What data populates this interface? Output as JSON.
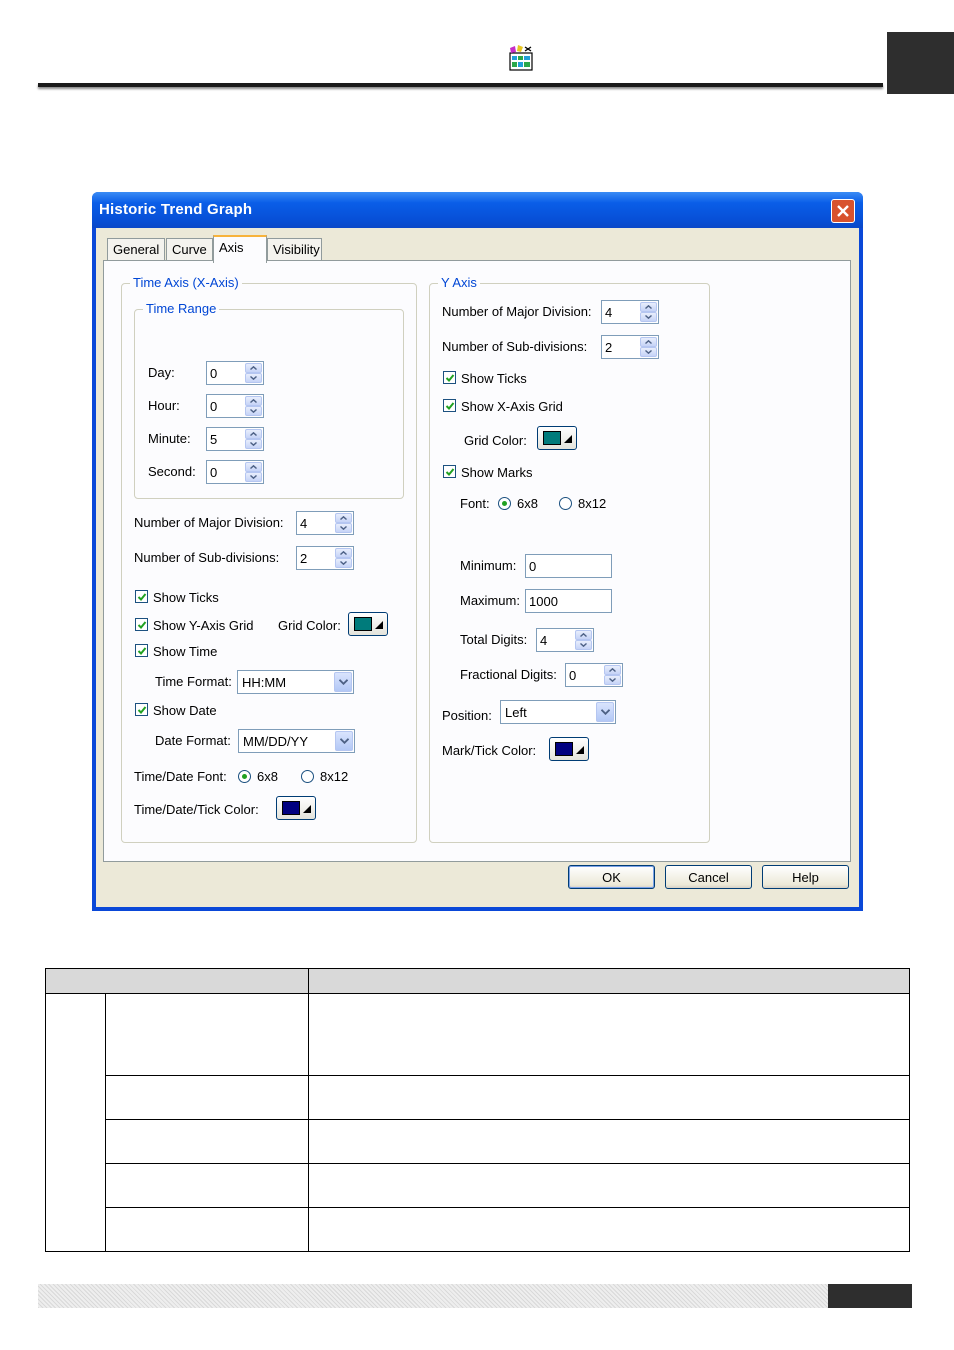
{
  "colors": {
    "titlebar": "#0a5ee8",
    "dialog_face": "#ece9d8",
    "group_legend": "#0046d5",
    "grid_color": "#007b7b",
    "tick_color": "#000080",
    "mark_tick_color": "#000080",
    "header_dark_block": "#2e2e2e",
    "table_header": "#d9d9d9"
  },
  "dialog": {
    "title": "Historic Trend Graph",
    "tabs": [
      {
        "label": "General"
      },
      {
        "label": "Curve"
      },
      {
        "label": "Axis"
      },
      {
        "label": "Visibility"
      }
    ],
    "active_tab": "Axis"
  },
  "x_axis": {
    "group_title": "Time Axis (X-Axis)",
    "time_range": {
      "group_title": "Time Range",
      "day_label": "Day:",
      "day_value": "0",
      "hour_label": "Hour:",
      "hour_value": "0",
      "minute_label": "Minute:",
      "minute_value": "5",
      "second_label": "Second:",
      "second_value": "0"
    },
    "major_div_label": "Number of Major Division:",
    "major_div_value": "4",
    "sub_div_label": "Number of Sub-divisions:",
    "sub_div_value": "2",
    "show_ticks_label": "Show Ticks",
    "show_ticks": true,
    "show_grid_label": "Show Y-Axis Grid",
    "show_grid": true,
    "grid_color_label": "Grid Color:",
    "show_time_label": "Show Time",
    "show_time": true,
    "time_format_label": "Time Format:",
    "time_format_value": "HH:MM",
    "show_date_label": "Show Date",
    "show_date": true,
    "date_format_label": "Date Format:",
    "date_format_value": "MM/DD/YY",
    "font_label": "Time/Date Font:",
    "font_opt1": "6x8",
    "font_opt2": "8x12",
    "font_selected": "6x8",
    "tick_color_label": "Time/Date/Tick Color:"
  },
  "y_axis": {
    "group_title": "Y Axis",
    "major_div_label": "Number of Major Division:",
    "major_div_value": "4",
    "sub_div_label": "Number of Sub-divisions:",
    "sub_div_value": "2",
    "show_ticks_label": "Show Ticks",
    "show_ticks": true,
    "show_grid_label": "Show X-Axis Grid",
    "show_grid": true,
    "grid_color_label": "Grid Color:",
    "show_marks_label": "Show Marks",
    "show_marks": true,
    "font_label": "Font:",
    "font_opt1": "6x8",
    "font_opt2": "8x12",
    "font_selected": "6x8",
    "minimum_label": "Minimum:",
    "minimum_value": "0",
    "maximum_label": "Maximum:",
    "maximum_value": "1000",
    "total_digits_label": "Total Digits:",
    "total_digits_value": "4",
    "fractional_digits_label": "Fractional Digits:",
    "fractional_digits_value": "0",
    "position_label": "Position:",
    "position_value": "Left",
    "mark_tick_color_label": "Mark/Tick Color:"
  },
  "buttons": {
    "ok": "OK",
    "cancel": "Cancel",
    "help": "Help"
  }
}
